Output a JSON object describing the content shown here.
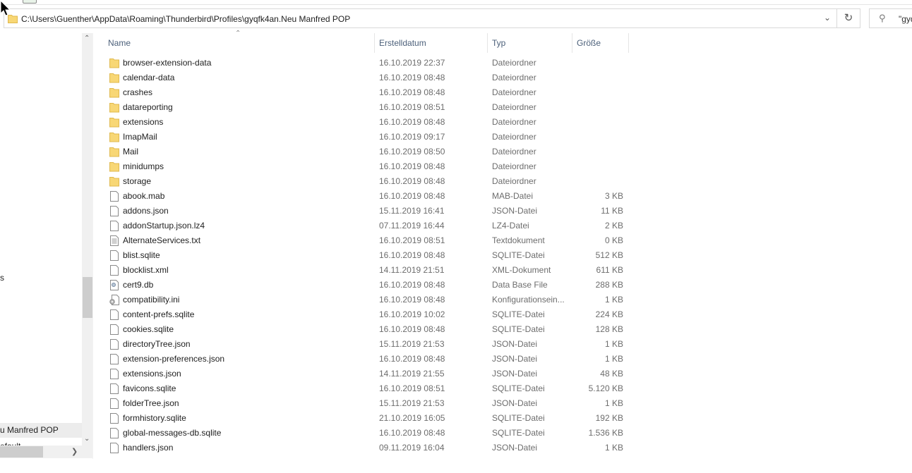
{
  "address_bar": {
    "path": "C:\\Users\\Guenther\\AppData\\Roaming\\Thunderbird\\Profiles\\gyqfk4an.Neu Manfred POP"
  },
  "search": {
    "value": "\"gyq"
  },
  "nav_pane": {
    "items": [
      {
        "label": "s"
      },
      {
        "label": "u Manfred POP",
        "selected": true
      },
      {
        "label": "efault"
      }
    ]
  },
  "columns": {
    "name": "Name",
    "created": "Erstelldatum",
    "type": "Typ",
    "size": "Größe"
  },
  "files": [
    {
      "name": "browser-extension-data",
      "created": "16.10.2019 22:37",
      "type": "Dateiordner",
      "size": "",
      "icon": "folder"
    },
    {
      "name": "calendar-data",
      "created": "16.10.2019 08:48",
      "type": "Dateiordner",
      "size": "",
      "icon": "folder"
    },
    {
      "name": "crashes",
      "created": "16.10.2019 08:48",
      "type": "Dateiordner",
      "size": "",
      "icon": "folder"
    },
    {
      "name": "datareporting",
      "created": "16.10.2019 08:51",
      "type": "Dateiordner",
      "size": "",
      "icon": "folder"
    },
    {
      "name": "extensions",
      "created": "16.10.2019 08:48",
      "type": "Dateiordner",
      "size": "",
      "icon": "folder"
    },
    {
      "name": "ImapMail",
      "created": "16.10.2019 09:17",
      "type": "Dateiordner",
      "size": "",
      "icon": "folder"
    },
    {
      "name": "Mail",
      "created": "16.10.2019 08:50",
      "type": "Dateiordner",
      "size": "",
      "icon": "folder"
    },
    {
      "name": "minidumps",
      "created": "16.10.2019 08:48",
      "type": "Dateiordner",
      "size": "",
      "icon": "folder"
    },
    {
      "name": "storage",
      "created": "16.10.2019 08:48",
      "type": "Dateiordner",
      "size": "",
      "icon": "folder"
    },
    {
      "name": "abook.mab",
      "created": "16.10.2019 08:48",
      "type": "MAB-Datei",
      "size": "3 KB",
      "icon": "file"
    },
    {
      "name": "addons.json",
      "created": "15.11.2019 16:41",
      "type": "JSON-Datei",
      "size": "11 KB",
      "icon": "file"
    },
    {
      "name": "addonStartup.json.lz4",
      "created": "07.11.2019 16:44",
      "type": "LZ4-Datei",
      "size": "2 KB",
      "icon": "file"
    },
    {
      "name": "AlternateServices.txt",
      "created": "16.10.2019 08:51",
      "type": "Textdokument",
      "size": "0 KB",
      "icon": "text-file"
    },
    {
      "name": "blist.sqlite",
      "created": "16.10.2019 08:48",
      "type": "SQLITE-Datei",
      "size": "512 KB",
      "icon": "file"
    },
    {
      "name": "blocklist.xml",
      "created": "14.11.2019 21:51",
      "type": "XML-Dokument",
      "size": "611 KB",
      "icon": "file"
    },
    {
      "name": "cert9.db",
      "created": "16.10.2019 08:48",
      "type": "Data Base File",
      "size": "288 KB",
      "icon": "database-file"
    },
    {
      "name": "compatibility.ini",
      "created": "16.10.2019 08:48",
      "type": "Konfigurationsein...",
      "size": "1 KB",
      "icon": "settings-file"
    },
    {
      "name": "content-prefs.sqlite",
      "created": "16.10.2019 10:02",
      "type": "SQLITE-Datei",
      "size": "224 KB",
      "icon": "file"
    },
    {
      "name": "cookies.sqlite",
      "created": "16.10.2019 08:48",
      "type": "SQLITE-Datei",
      "size": "128 KB",
      "icon": "file"
    },
    {
      "name": "directoryTree.json",
      "created": "15.11.2019 21:53",
      "type": "JSON-Datei",
      "size": "1 KB",
      "icon": "file"
    },
    {
      "name": "extension-preferences.json",
      "created": "16.10.2019 08:48",
      "type": "JSON-Datei",
      "size": "1 KB",
      "icon": "file"
    },
    {
      "name": "extensions.json",
      "created": "14.11.2019 21:55",
      "type": "JSON-Datei",
      "size": "48 KB",
      "icon": "file"
    },
    {
      "name": "favicons.sqlite",
      "created": "16.10.2019 08:51",
      "type": "SQLITE-Datei",
      "size": "5.120 KB",
      "icon": "file"
    },
    {
      "name": "folderTree.json",
      "created": "15.11.2019 21:53",
      "type": "JSON-Datei",
      "size": "1 KB",
      "icon": "file"
    },
    {
      "name": "formhistory.sqlite",
      "created": "21.10.2019 16:05",
      "type": "SQLITE-Datei",
      "size": "192 KB",
      "icon": "file"
    },
    {
      "name": "global-messages-db.sqlite",
      "created": "16.10.2019 08:48",
      "type": "SQLITE-Datei",
      "size": "1.536 KB",
      "icon": "file"
    },
    {
      "name": "handlers.json",
      "created": "09.11.2019 16:04",
      "type": "JSON-Datei",
      "size": "1 KB",
      "icon": "file"
    }
  ],
  "colors": {
    "folder": "#f8d775",
    "folder_edge": "#e0b94e",
    "header_text": "#4c607a",
    "selected_nav": "#ececec"
  }
}
